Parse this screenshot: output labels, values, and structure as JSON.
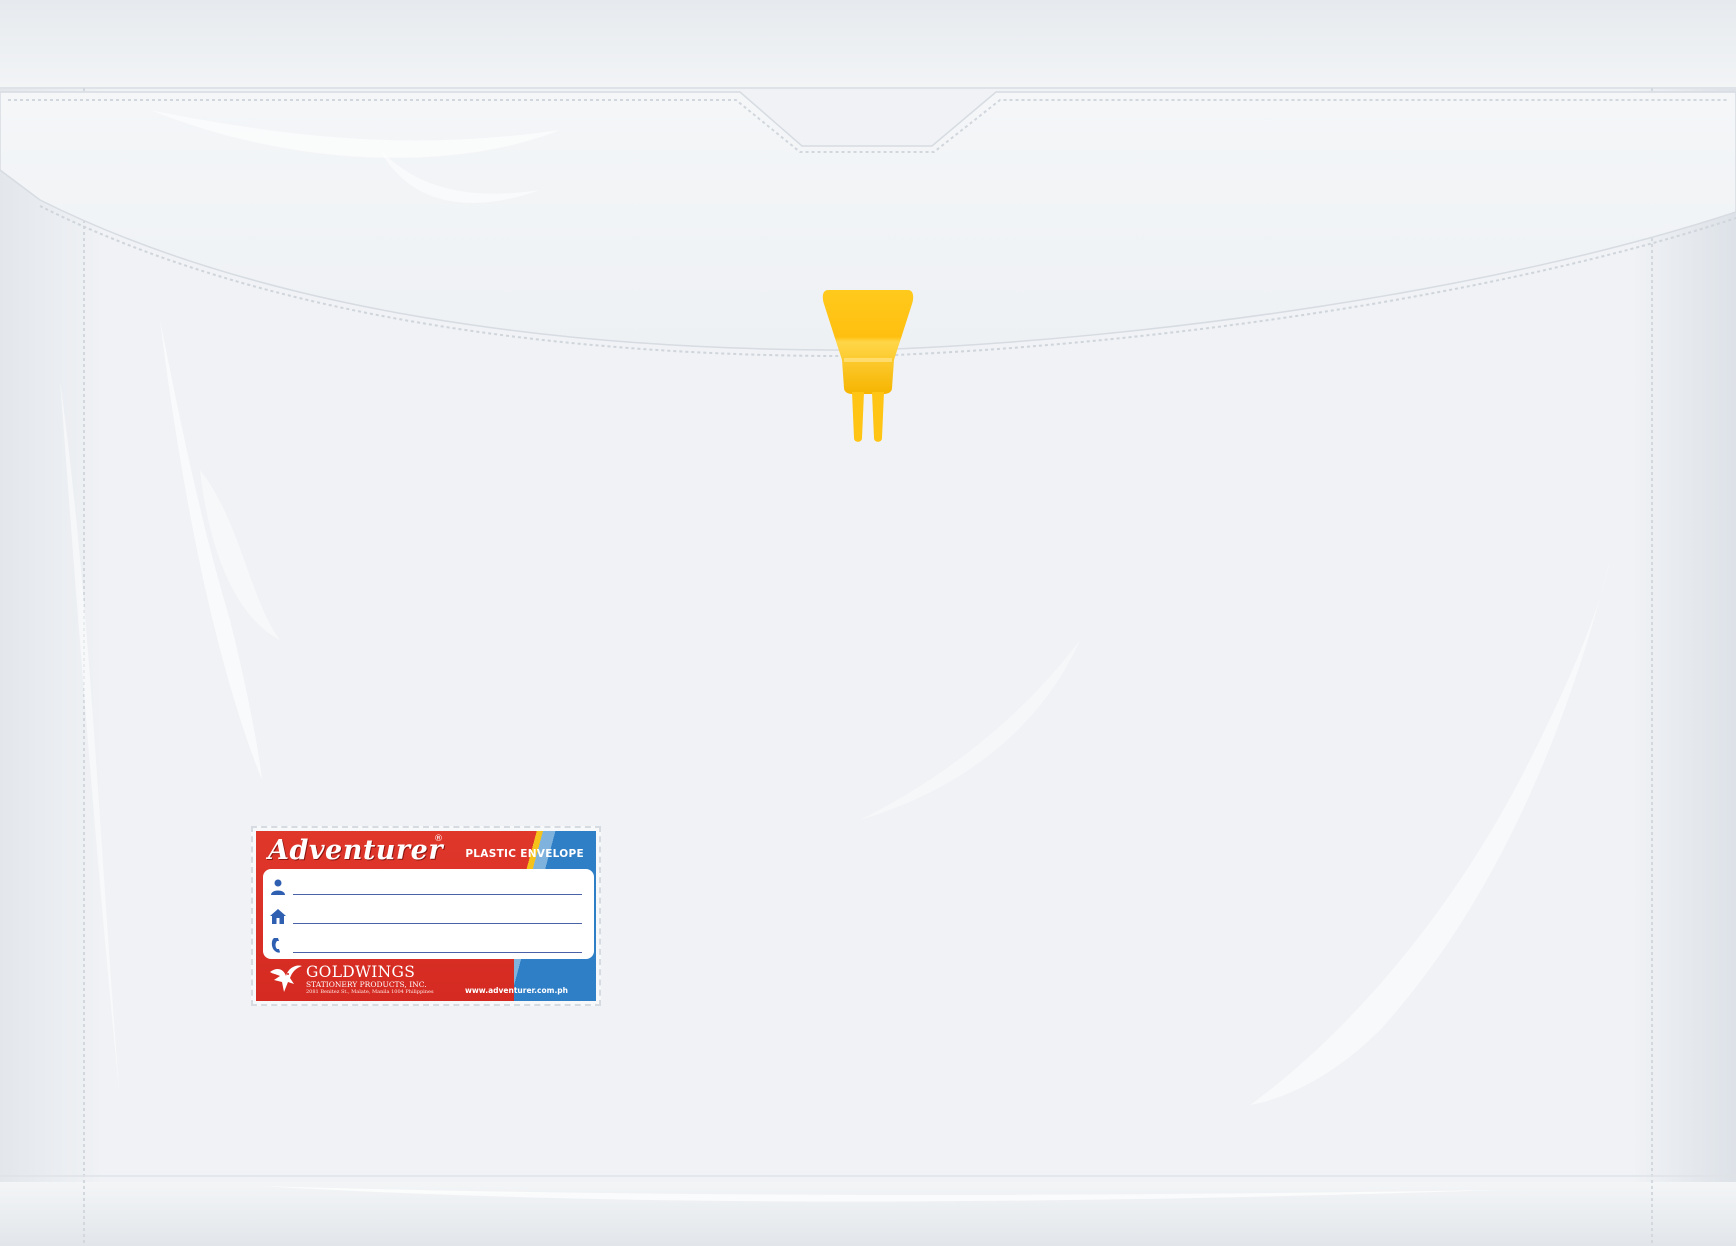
{
  "envelope": {
    "material": "clear plastic",
    "clasp_color": "#ffc414",
    "clasp_icon": "string-tie-clasp-icon"
  },
  "label": {
    "brand": "Adventurer",
    "registered_mark": "®",
    "product_type": "PLASTIC ENVELOPE",
    "fields": [
      {
        "icon": "person-icon"
      },
      {
        "icon": "house-icon"
      },
      {
        "icon": "phone-icon"
      }
    ],
    "company": "GOLDWINGS",
    "company_sub": "STATIONERY PRODUCTS, INC.",
    "address": "2081 Benitez St., Malate, Manila 1004 Philippines",
    "website": "www.adventurer.com.ph",
    "colors": {
      "red": "#d8301f",
      "yellow": "#f5c21b",
      "blue": "#2f7fc7",
      "ink": "#4a62a8"
    },
    "logo_icon": "eagle-icon"
  }
}
